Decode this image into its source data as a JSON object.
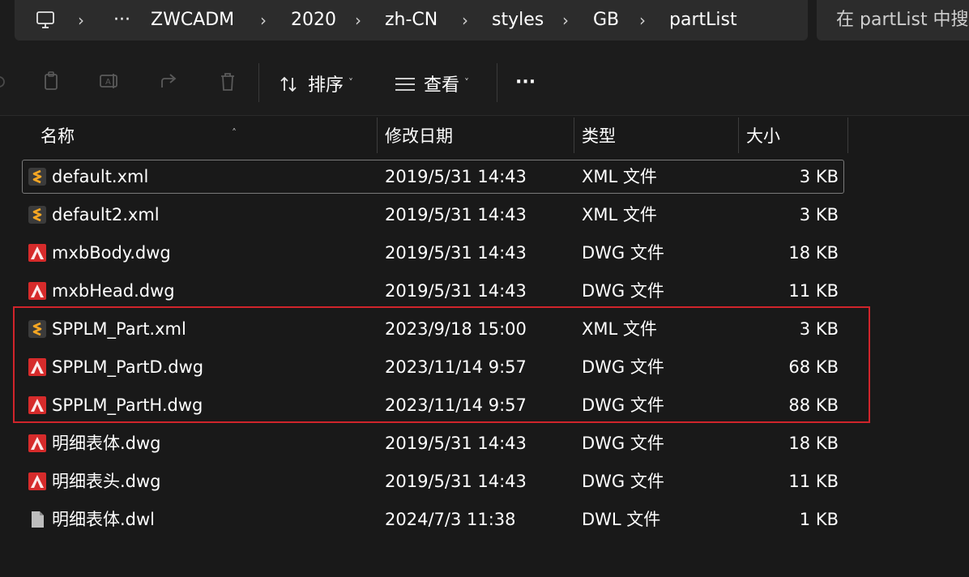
{
  "address_bar": {
    "breadcrumbs": [
      "ZWCADM",
      "2020",
      "zh-CN",
      "styles",
      "GB",
      "partList"
    ],
    "overflow_label": "···"
  },
  "search": {
    "placeholder": "在 partList 中搜"
  },
  "toolbar": {
    "sort_label": "排序",
    "view_label": "查看",
    "more_label": "···"
  },
  "columns": {
    "name": "名称",
    "modified": "修改日期",
    "type": "类型",
    "size": "大小"
  },
  "files": [
    {
      "name": "default.xml",
      "modified": "2019/5/31 14:43",
      "type": "XML 文件",
      "size": "3 KB",
      "icon": "xml-file-icon"
    },
    {
      "name": "default2.xml",
      "modified": "2019/5/31 14:43",
      "type": "XML 文件",
      "size": "3 KB",
      "icon": "xml-file-icon"
    },
    {
      "name": "mxbBody.dwg",
      "modified": "2019/5/31 14:43",
      "type": "DWG 文件",
      "size": "18 KB",
      "icon": "dwg-file-icon"
    },
    {
      "name": "mxbHead.dwg",
      "modified": "2019/5/31 14:43",
      "type": "DWG 文件",
      "size": "11 KB",
      "icon": "dwg-file-icon"
    },
    {
      "name": "SPPLM_Part.xml",
      "modified": "2023/9/18 15:00",
      "type": "XML 文件",
      "size": "3 KB",
      "icon": "xml-file-icon"
    },
    {
      "name": "SPPLM_PartD.dwg",
      "modified": "2023/11/14 9:57",
      "type": "DWG 文件",
      "size": "68 KB",
      "icon": "dwg-file-icon"
    },
    {
      "name": "SPPLM_PartH.dwg",
      "modified": "2023/11/14 9:57",
      "type": "DWG 文件",
      "size": "88 KB",
      "icon": "dwg-file-icon"
    },
    {
      "name": "明细表体.dwg",
      "modified": "2019/5/31 14:43",
      "type": "DWG 文件",
      "size": "18 KB",
      "icon": "dwg-file-icon"
    },
    {
      "name": "明细表头.dwg",
      "modified": "2019/5/31 14:43",
      "type": "DWG 文件",
      "size": "11 KB",
      "icon": "dwg-file-icon"
    },
    {
      "name": "明细表体.dwl",
      "modified": "2024/7/3 11:38",
      "type": "DWL 文件",
      "size": "1 KB",
      "icon": "generic-file-icon"
    }
  ],
  "colors": {
    "background": "#1c1c1c",
    "highlight_border": "#d0242b",
    "xml_icon": "#f5a623",
    "dwg_icon": "#d62b2b"
  }
}
